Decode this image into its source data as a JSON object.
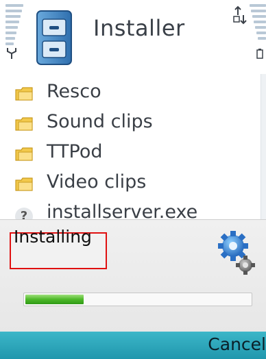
{
  "header": {
    "title": "Installer",
    "app_icon": "file-cabinet-icon",
    "left_indicator": "signal-strength-icon",
    "right_indicator": "battery-level-icon",
    "status_icon": "packet-data-icon"
  },
  "file_list": {
    "items": [
      {
        "label": "Resco",
        "icon": "folder-icon"
      },
      {
        "label": "Sound clips",
        "icon": "folder-icon"
      },
      {
        "label": "TTPod",
        "icon": "folder-icon"
      },
      {
        "label": "Video clips",
        "icon": "folder-icon"
      },
      {
        "label": "installserver.exe",
        "icon": "unknown-file-icon"
      }
    ]
  },
  "dialog": {
    "status": "Installing",
    "icon": "gears-icon",
    "progress_fraction": 0.26,
    "accent_color": "#e01010"
  },
  "softkeys": {
    "right": "Cancel"
  },
  "colors": {
    "softkey_bar": "#2aa6bb",
    "progress_fill": "#4cb828",
    "folder": "#f2c94c"
  }
}
